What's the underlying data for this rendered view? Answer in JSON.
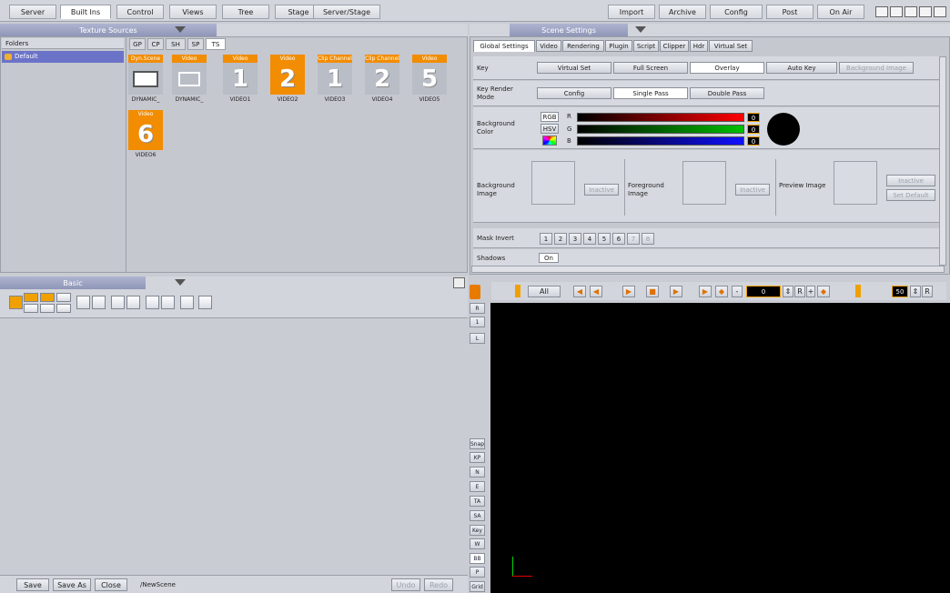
{
  "topbar": {
    "tabs": [
      "Server",
      "Built Ins",
      "Control",
      "Views",
      "Tree",
      "Stage",
      "Server/Stage"
    ],
    "right": [
      "Import",
      "Archive",
      "Config",
      "Post",
      "On Air"
    ]
  },
  "texture_sources": {
    "title": "Texture Sources",
    "folders_label": "Folders",
    "folder": "Default",
    "subtabs": [
      "GP",
      "CP",
      "SH",
      "SP",
      "TS"
    ],
    "items": [
      {
        "cap": "Dyn.Scene",
        "glyph": "",
        "label": "DYNAMIC_"
      },
      {
        "cap": "Video",
        "glyph": "",
        "label": "DYNAMIC_"
      },
      {
        "cap": "Video",
        "glyph": "1",
        "label": "VIDEO1"
      },
      {
        "cap": "Video",
        "glyph": "2",
        "label": "VIDEO2"
      },
      {
        "cap": "Clip Channel",
        "glyph": "1",
        "label": "VIDEO3"
      },
      {
        "cap": "Clip Channel",
        "glyph": "2",
        "label": "VIDEO4"
      },
      {
        "cap": "Video",
        "glyph": "5",
        "label": "VIDEO5"
      },
      {
        "cap": "Video",
        "glyph": "6",
        "label": "VIDEO6"
      }
    ]
  },
  "scene_settings": {
    "title": "Scene Settings",
    "tabs": [
      "Global Settings",
      "Video",
      "Rendering",
      "Plugin",
      "Script",
      "Clipper",
      "Hdr",
      "Virtual Set"
    ],
    "key_label": "Key",
    "key_opts": [
      "Virtual Set",
      "Full Screen",
      "Overlay",
      "Auto Key",
      "Background Image"
    ],
    "krm_label": "Key Render Mode",
    "krm_opts": [
      "Config",
      "Single Pass",
      "Double Pass"
    ],
    "bg_color_label": "Background Color",
    "rgb": "RGB",
    "hsv": "HSV",
    "channels": [
      "R",
      "G",
      "B"
    ],
    "channel_values": [
      "0",
      "0",
      "0"
    ],
    "bg_image_label": "Background Image",
    "fg_image_label": "Foreground Image",
    "preview_image_label": "Preview Image",
    "inactive": "Inactive",
    "set_default": "Set Default",
    "mask_invert_label": "Mask Invert",
    "mask_nums": [
      "1",
      "2",
      "3",
      "4",
      "5",
      "6",
      "7",
      "8"
    ],
    "shadows_label": "Shadows",
    "shadows_value": "On"
  },
  "basic": {
    "title": "Basic"
  },
  "bottom": {
    "save": "Save",
    "save_as": "Save As",
    "close": "Close",
    "path": "/NewScene",
    "undo": "Undo",
    "redo": "Redo"
  },
  "viewer": {
    "all": "All",
    "frame": "0",
    "r": "R",
    "fps": "50",
    "side": [
      "R",
      "1",
      "L"
    ],
    "side_lower": [
      "Snap",
      "KP",
      "N",
      "E",
      "TA",
      "SA",
      "Key",
      "W",
      "BB",
      "P",
      "Grid"
    ]
  },
  "colors": {
    "accent": "#f28c00",
    "panel_head": "#9aa0c0",
    "viewport": "#000000"
  }
}
